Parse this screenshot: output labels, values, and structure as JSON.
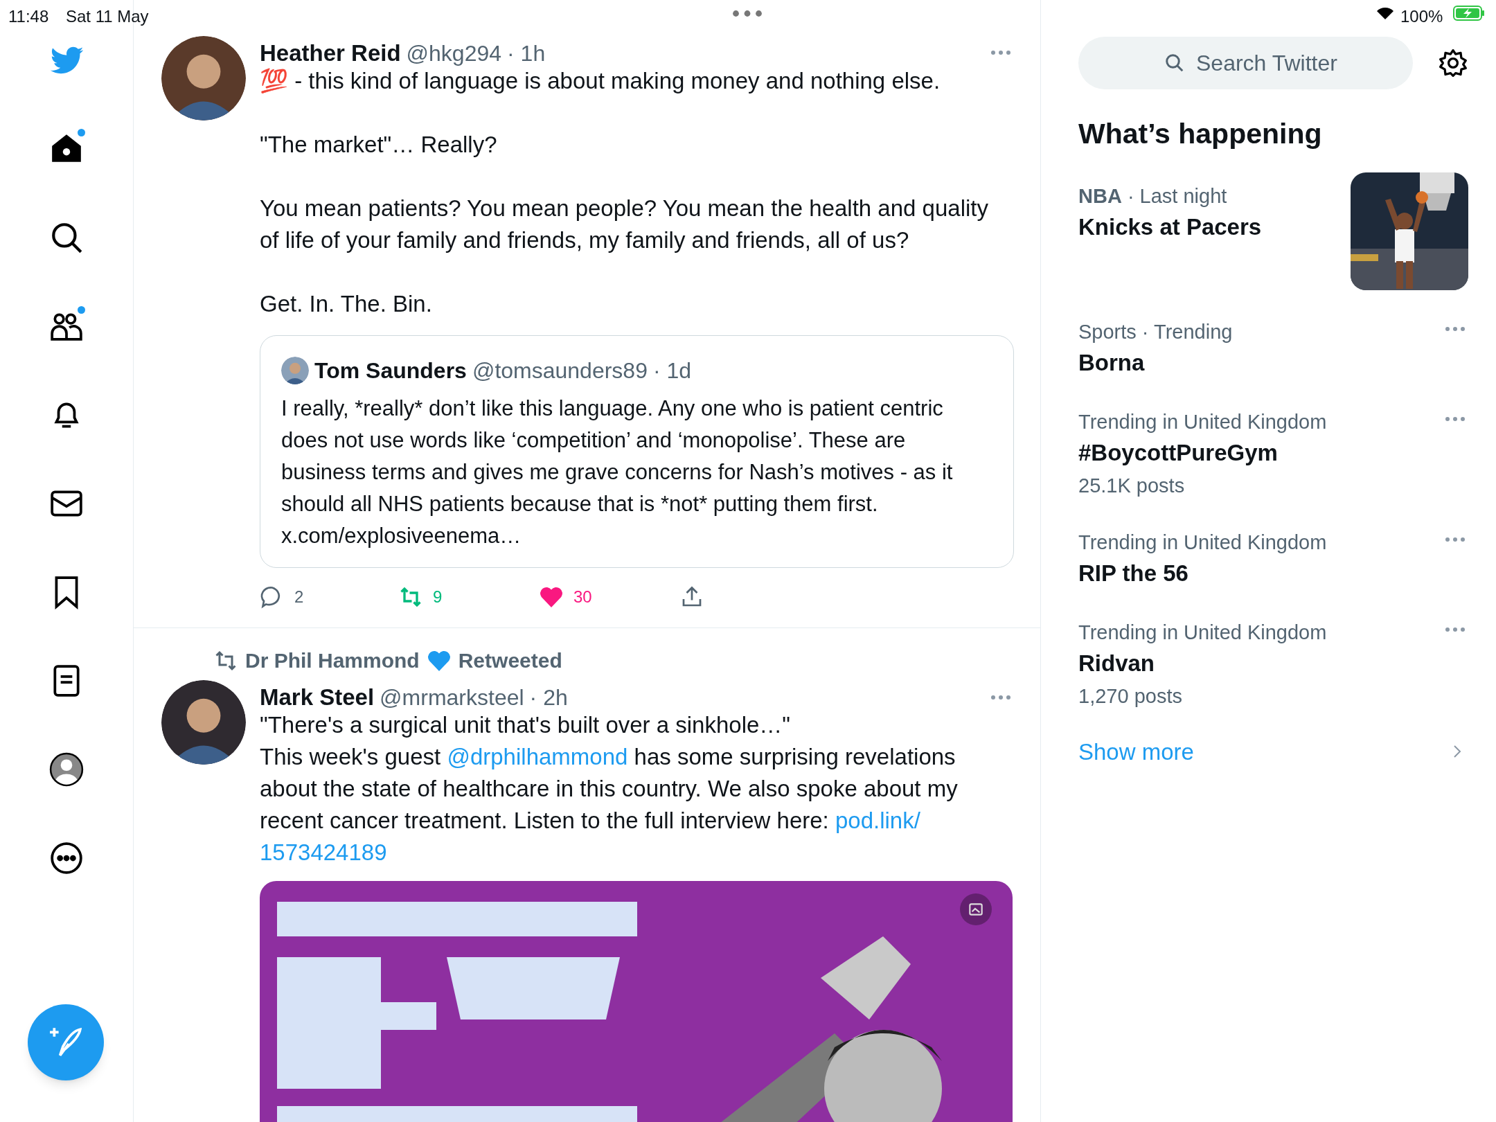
{
  "status_bar": {
    "time": "11:48",
    "date": "Sat 11 May",
    "battery": "100%"
  },
  "sidebar": {
    "items": [
      {
        "kind": "logo",
        "dot": false
      },
      {
        "kind": "home",
        "dot": true
      },
      {
        "kind": "explore",
        "dot": false
      },
      {
        "kind": "communities",
        "dot": true
      },
      {
        "kind": "notifications",
        "dot": false
      },
      {
        "kind": "messages",
        "dot": false
      },
      {
        "kind": "bookmarks",
        "dot": false
      },
      {
        "kind": "lists",
        "dot": false
      },
      {
        "kind": "profile",
        "dot": false
      },
      {
        "kind": "more",
        "dot": false
      }
    ]
  },
  "timeline": [
    {
      "name": "Heather Reid",
      "handle": "@hkg294",
      "time": "· 1h",
      "paragraphs": [
        [
          {
            "text": "💯 - this kind of language is about making money and nothing else.",
            "kind": "text"
          }
        ],
        [
          {
            "text": "\"The market\"… Really?",
            "kind": "text"
          }
        ],
        [
          {
            "text": "You mean patients? You mean people? You mean the health and quality of life of your family and friends, my family and friends, all of us?",
            "kind": "text"
          }
        ],
        [
          {
            "text": "Get. In. The. Bin.",
            "kind": "text"
          }
        ]
      ],
      "quote": {
        "name": "Tom Saunders",
        "handle": "@tomsaunders89",
        "time": "· 1d",
        "text": "I really, *really* don’t like this language. Any one who is patient centric does not use words like ‘competition’ and ‘monopolise’. These are business terms and gives me grave concerns for Nash’s motives - as it should all NHS patients because that is *not* putting them first. x.com/explosiveenema…"
      },
      "actions": {
        "replies": "2",
        "retweets": "9",
        "likes": "30",
        "retweeted": true,
        "liked": true
      }
    },
    {
      "retweeted_by": "Dr Phil Hammond",
      "retweeted_label": "Retweeted",
      "name": "Mark Steel",
      "handle": "@mrmarksteel",
      "time": "· 2h",
      "paragraphs": [
        [
          {
            "text": "\"There's a surgical unit that's built over a sinkhole…\"",
            "kind": "text"
          }
        ],
        [
          {
            "text": "This week's guest ",
            "kind": "text"
          },
          {
            "text": "@drphilhammond",
            "kind": "link"
          },
          {
            "text": " has some surprising revelations about the state of healthcare in this country. We also spoke about my recent cancer treatment. Listen to the full interview here: ",
            "kind": "text"
          },
          {
            "text": "pod.link/",
            "kind": "link"
          },
          {
            "text": "1573424189",
            "kind": "link"
          }
        ]
      ],
      "media": {
        "kind": "picture"
      }
    }
  ],
  "sidebar_right": {
    "search": {
      "placeholder": "Search Twitter"
    },
    "heading": "What’s happening",
    "trends": [
      {
        "context": "**NBA** · Last night",
        "title": "Knicks at Pacers",
        "image": {
          "kind": "picture"
        }
      },
      {
        "context": "Sports · Trending",
        "title": "Borna"
      },
      {
        "context": "Trending in United Kingdom",
        "title": "#BoycottPureGym",
        "posts": "25.1K posts"
      },
      {
        "context": "Trending in United Kingdom",
        "title": "RIP the 56"
      },
      {
        "context": "Trending in United Kingdom",
        "title": "Ridvan",
        "posts": "1,270 posts"
      }
    ],
    "show_more": "Show more"
  }
}
